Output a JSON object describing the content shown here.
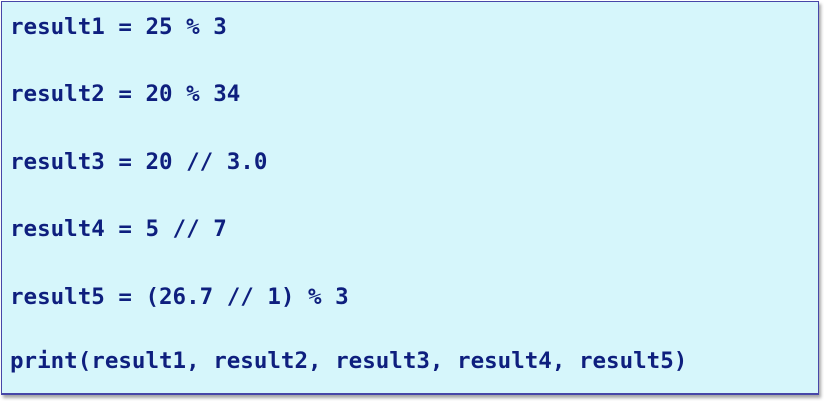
{
  "code": {
    "lines": [
      "result1 = 25 % 3",
      "result2 = 20 % 34",
      "result3 = 20 // 3.0",
      "result4 = 5 // 7",
      "result5 = (26.7 // 1) % 3",
      "print(result1, result2, result3, result4, result5)"
    ]
  },
  "colors": {
    "background": "#d6f6fb",
    "border": "#4747a8",
    "text": "#0e1f7e"
  }
}
